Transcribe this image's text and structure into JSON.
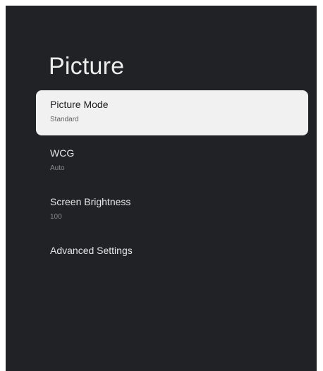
{
  "page": {
    "title": "Picture"
  },
  "menu": {
    "items": [
      {
        "label": "Picture Mode",
        "value": "Standard"
      },
      {
        "label": "WCG",
        "value": "Auto"
      },
      {
        "label": "Screen Brightness",
        "value": "100"
      },
      {
        "label": "Advanced Settings"
      }
    ]
  },
  "colors": {
    "background": "#212226",
    "selected_item": "#f1f1f1",
    "text_primary": "#ececec",
    "text_secondary": "#8c8c8f"
  }
}
